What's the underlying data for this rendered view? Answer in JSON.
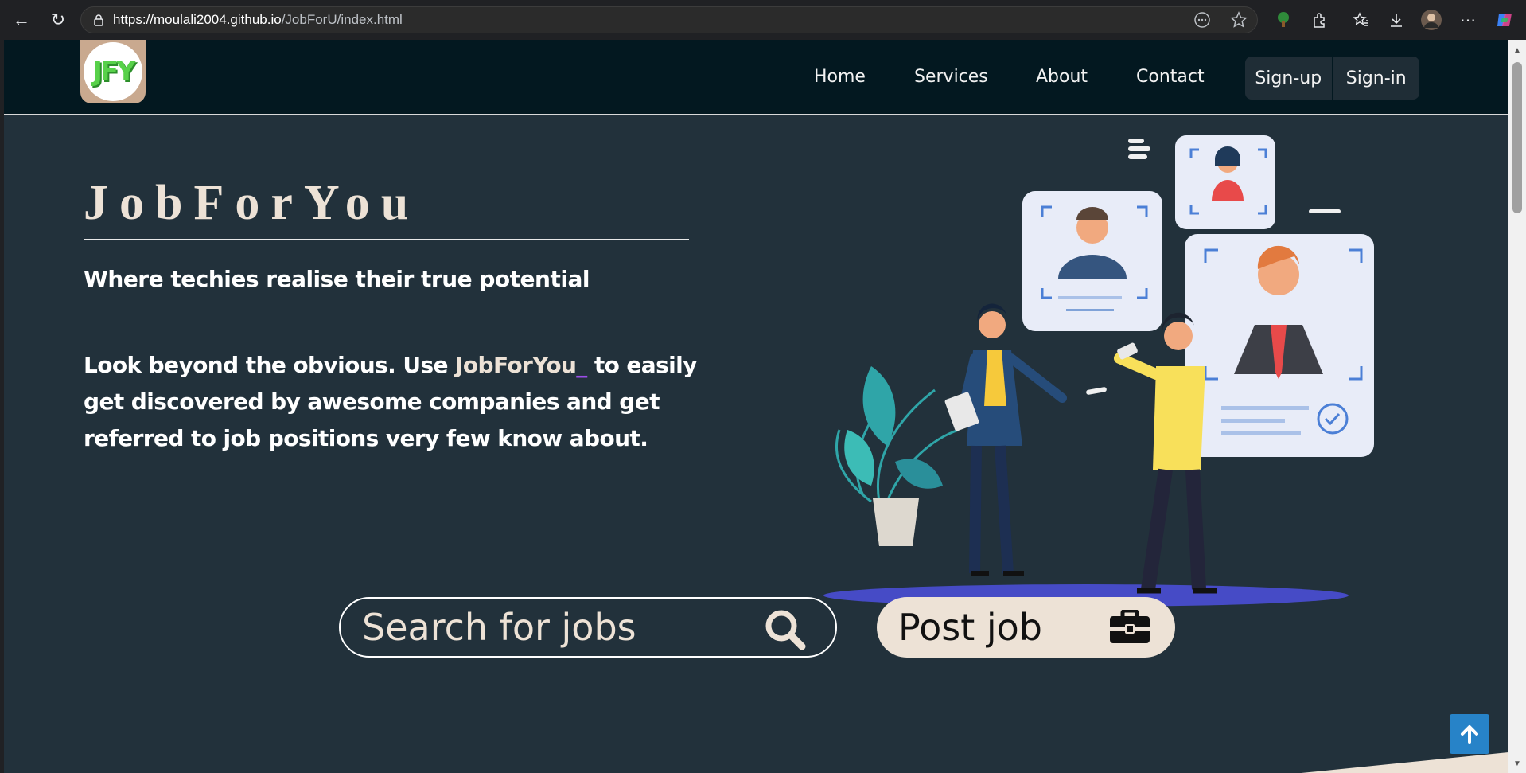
{
  "browser": {
    "url_host": "https://moulali2004.github.io",
    "url_path": "/JobForU/index.html"
  },
  "logo": {
    "text": "JFY"
  },
  "nav": {
    "home": "Home",
    "services": "Services",
    "about": "About",
    "contact": "Contact",
    "signup": "Sign-up",
    "signin": "Sign-in"
  },
  "hero": {
    "title": "JobForYou",
    "tagline": "Where techies realise their true potential",
    "desc_before": "Look beyond the obvious. Use ",
    "desc_brand": "JobForYou",
    "desc_cursor": "_",
    "desc_after": " to easily get discovered by awesome companies and get referred to job positions very few know about."
  },
  "actions": {
    "search_placeholder": "Search for jobs",
    "post_label": "Post job"
  },
  "icons": {
    "search": "search-icon",
    "post": "briefcase-icon",
    "back_to_top": "arrow-up-icon"
  },
  "colors": {
    "page_bg": "#22313b",
    "nav_bg": "#031820",
    "accent_cream": "#ede2d6",
    "top_button": "#2783c8"
  }
}
